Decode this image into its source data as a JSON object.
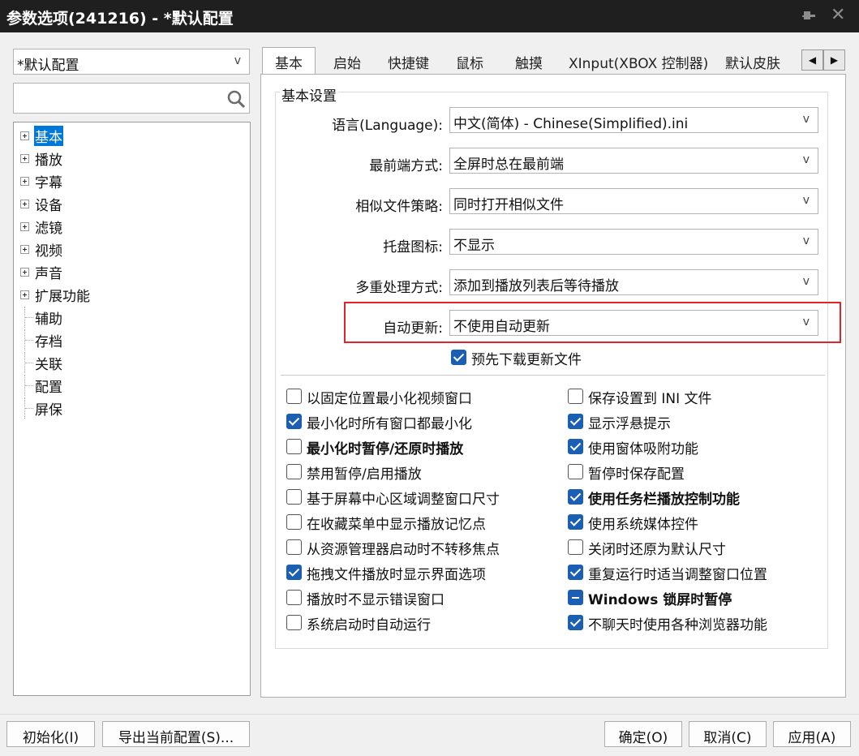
{
  "window": {
    "title": "参数选项(241216) - *默认配置"
  },
  "sidebar": {
    "profile": "*默认配置",
    "search_placeholder": "",
    "tree": [
      {
        "label": "基本",
        "expandable": true,
        "selected": true
      },
      {
        "label": "播放",
        "expandable": true
      },
      {
        "label": "字幕",
        "expandable": true
      },
      {
        "label": "设备",
        "expandable": true
      },
      {
        "label": "滤镜",
        "expandable": true
      },
      {
        "label": "视频",
        "expandable": true
      },
      {
        "label": "声音",
        "expandable": true
      },
      {
        "label": "扩展功能",
        "expandable": true
      },
      {
        "label": "辅助",
        "expandable": false
      },
      {
        "label": "存档",
        "expandable": false
      },
      {
        "label": "关联",
        "expandable": false
      },
      {
        "label": "配置",
        "expandable": false
      },
      {
        "label": "屏保",
        "expandable": false
      }
    ]
  },
  "tabs": [
    "基本",
    "启始",
    "快捷键",
    "鼠标",
    "触摸",
    "XInput(XBOX 控制器)",
    "默认皮肤"
  ],
  "active_tab": "基本",
  "group": {
    "title": "基本设置",
    "rows": [
      {
        "label": "语言(Language):",
        "value": "中文(简体) - Chinese(Simplified).ini"
      },
      {
        "label": "最前端方式:",
        "value": "全屏时总在最前端"
      },
      {
        "label": "相似文件策略:",
        "value": "同时打开相似文件"
      },
      {
        "label": "托盘图标:",
        "value": "不显示"
      },
      {
        "label": "多重处理方式:",
        "value": "添加到播放列表后等待播放"
      },
      {
        "label": "自动更新:",
        "value": "不使用自动更新"
      }
    ],
    "predownload": {
      "label": "预先下载更新文件",
      "checked": true
    },
    "left_options": [
      {
        "label": "以固定位置最小化视频窗口",
        "state": "unchecked"
      },
      {
        "label": "最小化时所有窗口都最小化",
        "state": "checked"
      },
      {
        "label": "最小化时暂停/还原时播放",
        "state": "unchecked",
        "bold": true
      },
      {
        "label": "禁用暂停/启用播放",
        "state": "unchecked"
      },
      {
        "label": "基于屏幕中心区域调整窗口尺寸",
        "state": "unchecked"
      },
      {
        "label": "在收藏菜单中显示播放记忆点",
        "state": "unchecked"
      },
      {
        "label": "从资源管理器启动时不转移焦点",
        "state": "unchecked"
      },
      {
        "label": "拖拽文件播放时显示界面选项",
        "state": "checked"
      },
      {
        "label": "播放时不显示错误窗口",
        "state": "unchecked"
      },
      {
        "label": "系统启动时自动运行",
        "state": "unchecked"
      }
    ],
    "right_options": [
      {
        "label": "保存设置到 INI 文件",
        "state": "unchecked"
      },
      {
        "label": "显示浮悬提示",
        "state": "checked"
      },
      {
        "label": "使用窗体吸附功能",
        "state": "checked"
      },
      {
        "label": "暂停时保存配置",
        "state": "unchecked"
      },
      {
        "label": "使用任务栏播放控制功能",
        "state": "checked",
        "bold": true
      },
      {
        "label": "使用系统媒体控件",
        "state": "checked"
      },
      {
        "label": "关闭时还原为默认尺寸",
        "state": "unchecked"
      },
      {
        "label": "重复运行时适当调整窗口位置",
        "state": "checked"
      },
      {
        "label": "Windows 锁屏时暂停",
        "state": "indeterminate",
        "bold": true
      },
      {
        "label": "不聊天时使用各种浏览器功能",
        "state": "checked"
      }
    ]
  },
  "buttons": {
    "reset": "初始化(I)",
    "export": "导出当前配置(S)...",
    "ok": "确定(O)",
    "cancel": "取消(C)",
    "apply": "应用(A)"
  },
  "colors": {
    "accent": "#1a5fb4",
    "selection": "#0078d7",
    "highlight_border": "#e0242c",
    "titlebar": "#1f1f1f"
  }
}
